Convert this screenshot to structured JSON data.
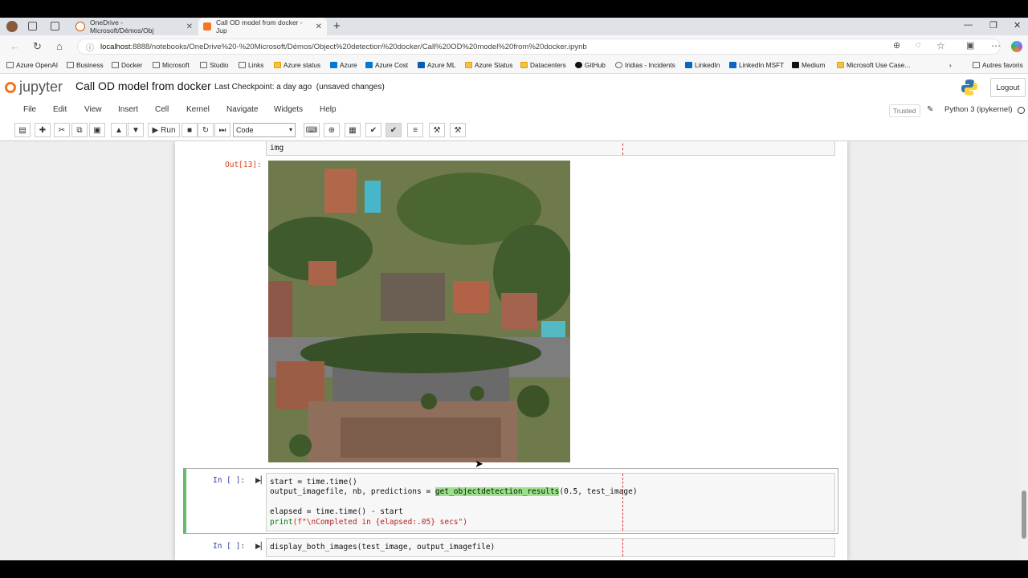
{
  "browser": {
    "tabs": [
      {
        "title": "OneDrive - Microsoft/Démos/Obj",
        "active": false
      },
      {
        "title": "Call OD model from docker - Jup",
        "active": true
      }
    ],
    "url_host": "localhost",
    "url_rest": ":8888/notebooks/OneDrive%20-%20Microsoft/Démos/Object%20detection%20docker/Call%20OD%20model%20from%20docker.ipynb",
    "bookmarks": [
      "Azure OpenAI",
      "Business",
      "Docker",
      "Microsoft",
      "Studio",
      "Links",
      "Azure status",
      "Azure",
      "Azure Cost",
      "Azure ML",
      "Azure Status",
      "Datacenters",
      "GitHub",
      "Iridias - Incidents",
      "LinkedIn",
      "LinkedIn MSFT",
      "Medium",
      "Microsoft Use Case..."
    ],
    "other_favorites": "Autres favoris"
  },
  "jupyter": {
    "logo_text": "jupyter",
    "notebook_title": "Call OD model from docker",
    "checkpoint": "Last Checkpoint: a day ago",
    "unsaved": "(unsaved changes)",
    "logout": "Logout",
    "menu": [
      "File",
      "Edit",
      "View",
      "Insert",
      "Cell",
      "Kernel",
      "Navigate",
      "Widgets",
      "Help"
    ],
    "trusted": "Trusted",
    "kernel": "Python 3 (ipykernel)",
    "run_label": "Run",
    "cell_type": "Code"
  },
  "cells": {
    "prev_code": "img",
    "out_prompt": "Out[13]:",
    "cell2_prompt": "In [ ]:",
    "cell2_lines": {
      "l1": "start = time.time()",
      "l2_a": "output_imagefile, nb, predictions = ",
      "l2_fn": "get_objectdetection_results",
      "l2_b": "(0.5, test_image)",
      "l3": "elapsed = time.time() - start",
      "l4_a": "print",
      "l4_b": "(f\"\\nCompleted in {elapsed:.05} secs\")"
    },
    "cell3_prompt": "In [ ]:",
    "cell3_code": "display_both_images(test_image, output_imagefile)"
  },
  "colors": {
    "jupyter_orange": "#f37626",
    "selected_cell_bar": "#66bb6a",
    "highlight": "#9be08a"
  }
}
